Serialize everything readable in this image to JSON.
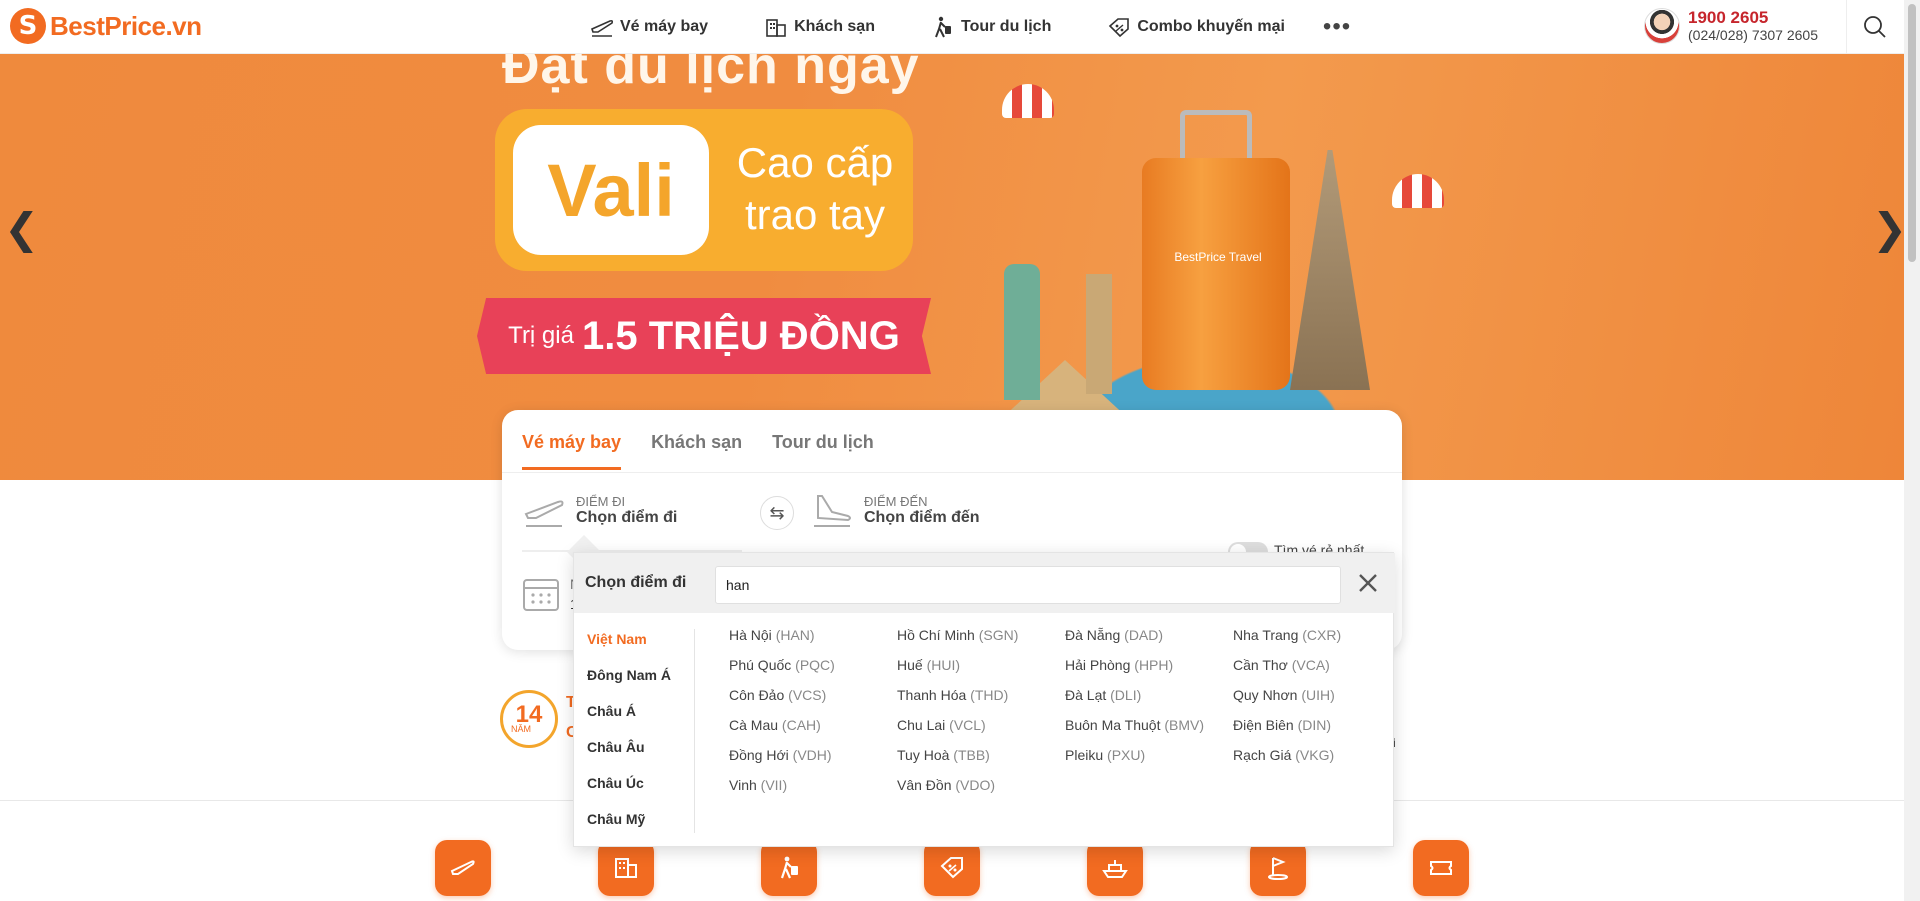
{
  "brand": {
    "name": "BestPrice.vn",
    "mark": "S",
    "accent": "#f26b21"
  },
  "nav": [
    {
      "label": "Vé máy bay",
      "icon": "plane-icon"
    },
    {
      "label": "Khách sạn",
      "icon": "hotel-icon"
    },
    {
      "label": "Tour du lịch",
      "icon": "traveler-icon"
    },
    {
      "label": "Combo khuyến mại",
      "icon": "ticket-percent-icon"
    }
  ],
  "nav_more": "•••",
  "contact": {
    "hotline": "1900 2605",
    "secondary": "(024/028) 7307 2605"
  },
  "banner": {
    "headline": "Đặt du lịch ngay",
    "vali": "Vali",
    "vali_side": "Cao cấp trao tay",
    "price_prefix": "Trị giá",
    "price_value": "1.5 TRIỆU ĐỒNG",
    "suitcase_brand": "BestPrice Travel",
    "prev": "❮",
    "next": "❯",
    "slides": 3
  },
  "search": {
    "tabs": [
      {
        "label": "Vé máy bay",
        "active": true
      },
      {
        "label": "Khách sạn",
        "active": false
      },
      {
        "label": "Tour du lịch",
        "active": false
      }
    ],
    "origin": {
      "label": "Điểm đi",
      "value": "Chọn điểm đi"
    },
    "destination": {
      "label": "Điểm đến",
      "value": "Chọn điểm đến"
    },
    "swap": "⇆",
    "cheapest_label": "Tìm vé rẻ nhất",
    "date_partial_1": "N",
    "date_partial_2": "1"
  },
  "dropdown": {
    "title": "Chọn điểm đi",
    "query": "han",
    "regions": [
      {
        "label": "Việt Nam",
        "active": true
      },
      {
        "label": "Đông Nam Á",
        "active": false
      },
      {
        "label": "Châu Á",
        "active": false
      },
      {
        "label": "Châu Âu",
        "active": false
      },
      {
        "label": "Châu Úc",
        "active": false
      },
      {
        "label": "Châu Mỹ",
        "active": false
      }
    ],
    "cities": [
      {
        "name": "Hà Nội",
        "code": "(HAN)"
      },
      {
        "name": "Hồ Chí Minh",
        "code": "(SGN)"
      },
      {
        "name": "Đà Nẵng",
        "code": "(DAD)"
      },
      {
        "name": "Nha Trang",
        "code": "(CXR)"
      },
      {
        "name": "Phú Quốc",
        "code": "(PQC)"
      },
      {
        "name": "Huế",
        "code": "(HUI)"
      },
      {
        "name": "Hải Phòng",
        "code": "(HPH)"
      },
      {
        "name": "Cần Thơ",
        "code": "(VCA)"
      },
      {
        "name": "Côn Đảo",
        "code": "(VCS)"
      },
      {
        "name": "Thanh Hóa",
        "code": "(THD)"
      },
      {
        "name": "Đà Lạt",
        "code": "(DLI)"
      },
      {
        "name": "Quy Nhơn",
        "code": "(UIH)"
      },
      {
        "name": "Cà Mau",
        "code": "(CAH)"
      },
      {
        "name": "Chu Lai",
        "code": "(VCL)"
      },
      {
        "name": "Buôn Ma Thuột",
        "code": "(BMV)"
      },
      {
        "name": "Điện Biên",
        "code": "(DIN)"
      },
      {
        "name": "Đồng Hới",
        "code": "(VDH)"
      },
      {
        "name": "Tuy Hoà",
        "code": "(TBB)"
      },
      {
        "name": "Pleiku",
        "code": "(PXU)"
      },
      {
        "name": "Rạch Giá",
        "code": "(VKG)"
      },
      {
        "name": "Vinh",
        "code": "(VII)"
      },
      {
        "name": "Vân Đồn",
        "code": "(VDO)"
      }
    ]
  },
  "award": {
    "years": "14",
    "unit": "NĂM",
    "t1": "T",
    "t2": "C",
    "t3": "i"
  },
  "services": [
    {
      "icon": "plane-icon"
    },
    {
      "icon": "hotel-icon"
    },
    {
      "icon": "traveler-icon"
    },
    {
      "icon": "ticket-percent-icon"
    },
    {
      "icon": "cruise-ship-icon"
    },
    {
      "icon": "golf-icon"
    },
    {
      "icon": "voucher-icon"
    }
  ]
}
